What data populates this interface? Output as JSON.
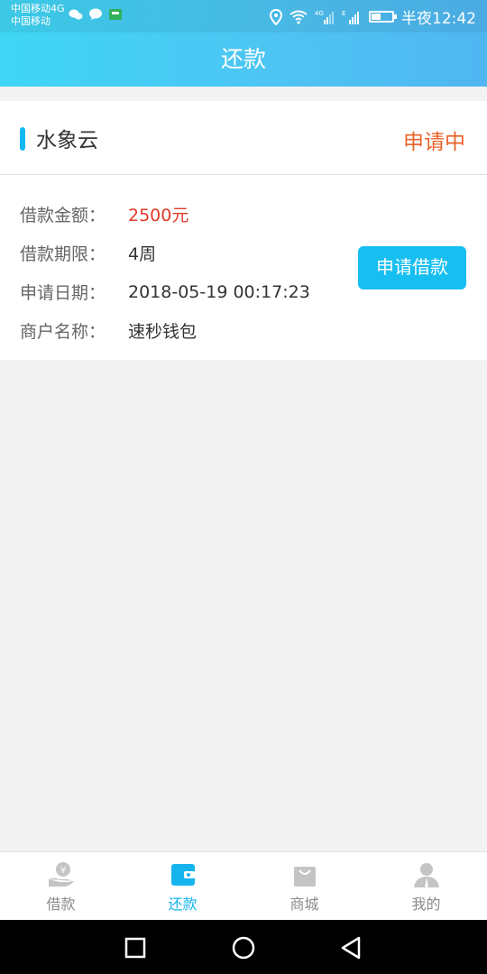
{
  "status_bar": {
    "carrier1": "中国移动4G",
    "carrier2": "中国移动",
    "time": "半夜12:42",
    "battery_level": 0.45
  },
  "header": {
    "title": "还款"
  },
  "loan_card": {
    "lender": "水象云",
    "status": "申请中",
    "rows": [
      {
        "label": "借款金额：",
        "value": "2500元"
      },
      {
        "label": "借款期限：",
        "value": "4周"
      },
      {
        "label": "申请日期：",
        "value": "2018-05-19 00:17:23"
      },
      {
        "label": "商户名称：",
        "value": "速秒钱包"
      }
    ],
    "apply_button": "申请借款"
  },
  "bottom_nav": [
    {
      "label": "借款",
      "icon": "loan-icon"
    },
    {
      "label": "还款",
      "icon": "wallet-icon",
      "active": true
    },
    {
      "label": "商城",
      "icon": "shopping-bag-icon"
    },
    {
      "label": "我的",
      "icon": "profile-icon"
    }
  ],
  "colors": {
    "accent": "#17bff1",
    "status_orange": "#e8642b",
    "amount_red": "#e23a2a"
  }
}
